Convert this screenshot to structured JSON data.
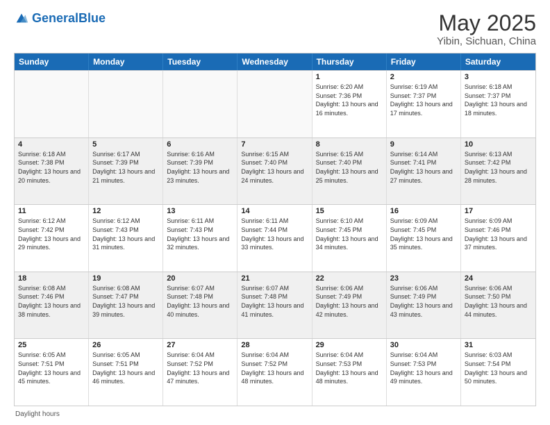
{
  "header": {
    "logo_general": "General",
    "logo_blue": "Blue",
    "title": "May 2025",
    "subtitle": "Yibin, Sichuan, China"
  },
  "weekdays": [
    "Sunday",
    "Monday",
    "Tuesday",
    "Wednesday",
    "Thursday",
    "Friday",
    "Saturday"
  ],
  "rows": [
    [
      {
        "day": "",
        "sunrise": "",
        "sunset": "",
        "daylight": "",
        "empty": true
      },
      {
        "day": "",
        "sunrise": "",
        "sunset": "",
        "daylight": "",
        "empty": true
      },
      {
        "day": "",
        "sunrise": "",
        "sunset": "",
        "daylight": "",
        "empty": true
      },
      {
        "day": "",
        "sunrise": "",
        "sunset": "",
        "daylight": "",
        "empty": true
      },
      {
        "day": "1",
        "sunrise": "Sunrise: 6:20 AM",
        "sunset": "Sunset: 7:36 PM",
        "daylight": "Daylight: 13 hours and 16 minutes.",
        "empty": false
      },
      {
        "day": "2",
        "sunrise": "Sunrise: 6:19 AM",
        "sunset": "Sunset: 7:37 PM",
        "daylight": "Daylight: 13 hours and 17 minutes.",
        "empty": false
      },
      {
        "day": "3",
        "sunrise": "Sunrise: 6:18 AM",
        "sunset": "Sunset: 7:37 PM",
        "daylight": "Daylight: 13 hours and 18 minutes.",
        "empty": false
      }
    ],
    [
      {
        "day": "4",
        "sunrise": "Sunrise: 6:18 AM",
        "sunset": "Sunset: 7:38 PM",
        "daylight": "Daylight: 13 hours and 20 minutes.",
        "empty": false
      },
      {
        "day": "5",
        "sunrise": "Sunrise: 6:17 AM",
        "sunset": "Sunset: 7:39 PM",
        "daylight": "Daylight: 13 hours and 21 minutes.",
        "empty": false
      },
      {
        "day": "6",
        "sunrise": "Sunrise: 6:16 AM",
        "sunset": "Sunset: 7:39 PM",
        "daylight": "Daylight: 13 hours and 23 minutes.",
        "empty": false
      },
      {
        "day": "7",
        "sunrise": "Sunrise: 6:15 AM",
        "sunset": "Sunset: 7:40 PM",
        "daylight": "Daylight: 13 hours and 24 minutes.",
        "empty": false
      },
      {
        "day": "8",
        "sunrise": "Sunrise: 6:15 AM",
        "sunset": "Sunset: 7:40 PM",
        "daylight": "Daylight: 13 hours and 25 minutes.",
        "empty": false
      },
      {
        "day": "9",
        "sunrise": "Sunrise: 6:14 AM",
        "sunset": "Sunset: 7:41 PM",
        "daylight": "Daylight: 13 hours and 27 minutes.",
        "empty": false
      },
      {
        "day": "10",
        "sunrise": "Sunrise: 6:13 AM",
        "sunset": "Sunset: 7:42 PM",
        "daylight": "Daylight: 13 hours and 28 minutes.",
        "empty": false
      }
    ],
    [
      {
        "day": "11",
        "sunrise": "Sunrise: 6:12 AM",
        "sunset": "Sunset: 7:42 PM",
        "daylight": "Daylight: 13 hours and 29 minutes.",
        "empty": false
      },
      {
        "day": "12",
        "sunrise": "Sunrise: 6:12 AM",
        "sunset": "Sunset: 7:43 PM",
        "daylight": "Daylight: 13 hours and 31 minutes.",
        "empty": false
      },
      {
        "day": "13",
        "sunrise": "Sunrise: 6:11 AM",
        "sunset": "Sunset: 7:43 PM",
        "daylight": "Daylight: 13 hours and 32 minutes.",
        "empty": false
      },
      {
        "day": "14",
        "sunrise": "Sunrise: 6:11 AM",
        "sunset": "Sunset: 7:44 PM",
        "daylight": "Daylight: 13 hours and 33 minutes.",
        "empty": false
      },
      {
        "day": "15",
        "sunrise": "Sunrise: 6:10 AM",
        "sunset": "Sunset: 7:45 PM",
        "daylight": "Daylight: 13 hours and 34 minutes.",
        "empty": false
      },
      {
        "day": "16",
        "sunrise": "Sunrise: 6:09 AM",
        "sunset": "Sunset: 7:45 PM",
        "daylight": "Daylight: 13 hours and 35 minutes.",
        "empty": false
      },
      {
        "day": "17",
        "sunrise": "Sunrise: 6:09 AM",
        "sunset": "Sunset: 7:46 PM",
        "daylight": "Daylight: 13 hours and 37 minutes.",
        "empty": false
      }
    ],
    [
      {
        "day": "18",
        "sunrise": "Sunrise: 6:08 AM",
        "sunset": "Sunset: 7:46 PM",
        "daylight": "Daylight: 13 hours and 38 minutes.",
        "empty": false
      },
      {
        "day": "19",
        "sunrise": "Sunrise: 6:08 AM",
        "sunset": "Sunset: 7:47 PM",
        "daylight": "Daylight: 13 hours and 39 minutes.",
        "empty": false
      },
      {
        "day": "20",
        "sunrise": "Sunrise: 6:07 AM",
        "sunset": "Sunset: 7:48 PM",
        "daylight": "Daylight: 13 hours and 40 minutes.",
        "empty": false
      },
      {
        "day": "21",
        "sunrise": "Sunrise: 6:07 AM",
        "sunset": "Sunset: 7:48 PM",
        "daylight": "Daylight: 13 hours and 41 minutes.",
        "empty": false
      },
      {
        "day": "22",
        "sunrise": "Sunrise: 6:06 AM",
        "sunset": "Sunset: 7:49 PM",
        "daylight": "Daylight: 13 hours and 42 minutes.",
        "empty": false
      },
      {
        "day": "23",
        "sunrise": "Sunrise: 6:06 AM",
        "sunset": "Sunset: 7:49 PM",
        "daylight": "Daylight: 13 hours and 43 minutes.",
        "empty": false
      },
      {
        "day": "24",
        "sunrise": "Sunrise: 6:06 AM",
        "sunset": "Sunset: 7:50 PM",
        "daylight": "Daylight: 13 hours and 44 minutes.",
        "empty": false
      }
    ],
    [
      {
        "day": "25",
        "sunrise": "Sunrise: 6:05 AM",
        "sunset": "Sunset: 7:51 PM",
        "daylight": "Daylight: 13 hours and 45 minutes.",
        "empty": false
      },
      {
        "day": "26",
        "sunrise": "Sunrise: 6:05 AM",
        "sunset": "Sunset: 7:51 PM",
        "daylight": "Daylight: 13 hours and 46 minutes.",
        "empty": false
      },
      {
        "day": "27",
        "sunrise": "Sunrise: 6:04 AM",
        "sunset": "Sunset: 7:52 PM",
        "daylight": "Daylight: 13 hours and 47 minutes.",
        "empty": false
      },
      {
        "day": "28",
        "sunrise": "Sunrise: 6:04 AM",
        "sunset": "Sunset: 7:52 PM",
        "daylight": "Daylight: 13 hours and 48 minutes.",
        "empty": false
      },
      {
        "day": "29",
        "sunrise": "Sunrise: 6:04 AM",
        "sunset": "Sunset: 7:53 PM",
        "daylight": "Daylight: 13 hours and 48 minutes.",
        "empty": false
      },
      {
        "day": "30",
        "sunrise": "Sunrise: 6:04 AM",
        "sunset": "Sunset: 7:53 PM",
        "daylight": "Daylight: 13 hours and 49 minutes.",
        "empty": false
      },
      {
        "day": "31",
        "sunrise": "Sunrise: 6:03 AM",
        "sunset": "Sunset: 7:54 PM",
        "daylight": "Daylight: 13 hours and 50 minutes.",
        "empty": false
      }
    ]
  ],
  "footer": "Daylight hours"
}
